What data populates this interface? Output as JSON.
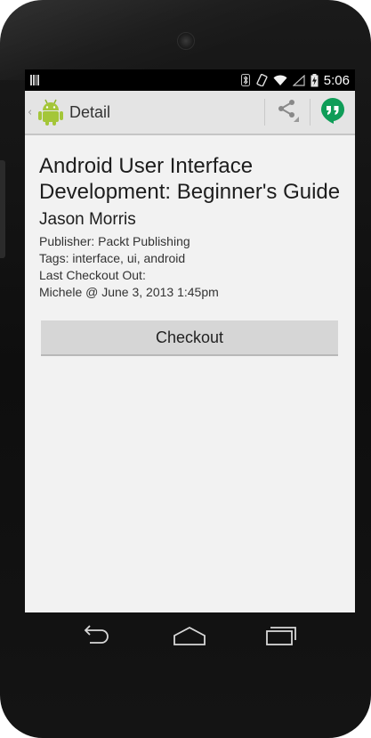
{
  "status_bar": {
    "time": "5:06",
    "icons": [
      "bluetooth-icon",
      "vibrate-icon",
      "wifi-icon",
      "signal-icon",
      "battery-charging-icon"
    ]
  },
  "action_bar": {
    "title": "Detail",
    "app_icon": "android-robot-icon",
    "actions": [
      "share-icon",
      "hangouts-icon"
    ]
  },
  "book": {
    "title": "Android User Interface Development: Beginner's Guide",
    "author": "Jason Morris",
    "publisher": "Publisher: Packt Publishing",
    "tags": "Tags: interface, ui, android",
    "checkout_label": "Last Checkout Out:",
    "checkout_value": "Michele @ June 3, 2013 1:45pm"
  },
  "buttons": {
    "checkout": "Checkout"
  },
  "nav": [
    "back-icon",
    "home-icon",
    "recent-apps-icon"
  ],
  "colors": {
    "action_bar_bg": "#e4e4e4",
    "screen_bg": "#f2f2f2",
    "button_bg": "#d6d6d6",
    "android_green": "#a4c639",
    "hangouts_green": "#0f9d58"
  }
}
